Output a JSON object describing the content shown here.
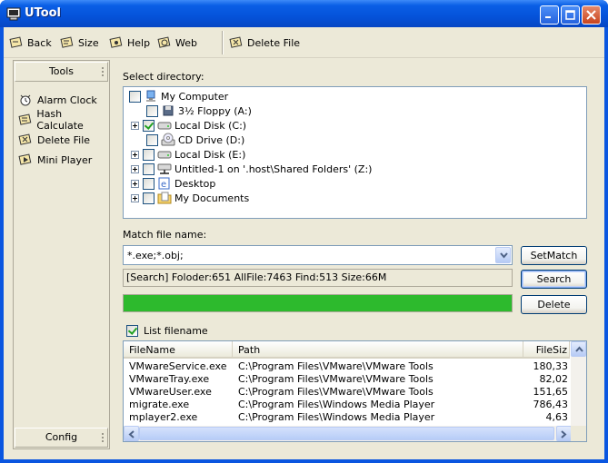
{
  "window": {
    "title": "UTool"
  },
  "toolbar": {
    "items": [
      {
        "label": "Back",
        "icon": "back-icon"
      },
      {
        "label": "Size",
        "icon": "size-icon"
      },
      {
        "label": "Help",
        "icon": "help-icon"
      },
      {
        "label": "Web",
        "icon": "web-icon"
      },
      {
        "label": "Delete File",
        "icon": "delete-file-icon"
      }
    ]
  },
  "sidebar": {
    "header": "Tools",
    "footer": "Config",
    "items": [
      {
        "label": "Alarm Clock",
        "icon": "alarm-clock-icon"
      },
      {
        "label": "Hash Calculate",
        "icon": "hash-icon"
      },
      {
        "label": "Delete File",
        "icon": "delete-file-icon"
      },
      {
        "label": "Mini Player",
        "icon": "mini-player-icon"
      }
    ]
  },
  "main": {
    "select_dir_label": "Select directory:",
    "tree": [
      {
        "label": "My Computer",
        "icon": "my-computer-icon",
        "checked": false
      },
      {
        "label": "3½ Floppy (A:)",
        "icon": "floppy-icon",
        "checked": false
      },
      {
        "label": "Local Disk (C:)",
        "icon": "hard-disk-icon",
        "checked": true
      },
      {
        "label": "CD Drive (D:)",
        "icon": "cd-drive-icon",
        "checked": false
      },
      {
        "label": "Local Disk (E:)",
        "icon": "hard-disk-icon",
        "checked": false
      },
      {
        "label": "Untitled-1 on '.host\\Shared Folders' (Z:)",
        "icon": "network-drive-icon",
        "checked": false
      },
      {
        "label": "Desktop",
        "icon": "desktop-icon",
        "checked": false
      },
      {
        "label": "My Documents",
        "icon": "my-documents-icon",
        "checked": false
      }
    ],
    "match_label": "Match file name:",
    "match_value": "*.exe;*.obj;",
    "status_text": "[Search] Foloder:651 AllFile:7463 Find:513 Size:66M",
    "progress": 1.0,
    "buttons": {
      "setmatch": "SetMatch",
      "search": "Search",
      "delete": "Delete"
    },
    "list_filename_label": "List filename",
    "list_filename_checked": true,
    "columns": [
      "FileName",
      "Path",
      "FileSiz"
    ],
    "rows": [
      [
        "VMwareService.exe",
        "C:\\Program Files\\VMware\\VMware Tools",
        "180,33"
      ],
      [
        "VMwareTray.exe",
        "C:\\Program Files\\VMware\\VMware Tools",
        "82,02"
      ],
      [
        "VMwareUser.exe",
        "C:\\Program Files\\VMware\\VMware Tools",
        "151,65"
      ],
      [
        "migrate.exe",
        "C:\\Program Files\\Windows Media Player",
        "786,43"
      ],
      [
        "mplayer2.exe",
        "C:\\Program Files\\Windows Media Player",
        "4,63"
      ]
    ]
  }
}
